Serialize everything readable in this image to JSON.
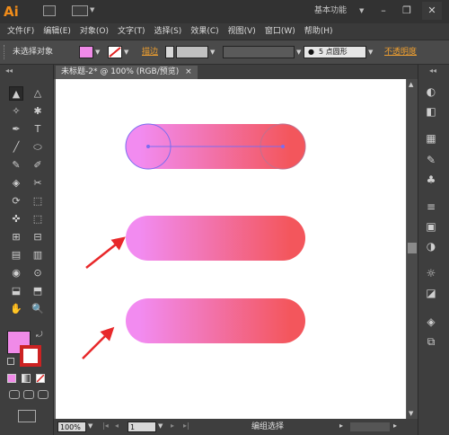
{
  "app": {
    "logo": "Ai",
    "workspace": "基本功能"
  },
  "window_buttons": {
    "minimize": "–",
    "restore": "❐",
    "close": "✕"
  },
  "menu": [
    "文件(F)",
    "编辑(E)",
    "对象(O)",
    "文字(T)",
    "选择(S)",
    "效果(C)",
    "视图(V)",
    "窗口(W)",
    "帮助(H)"
  ],
  "control": {
    "selection_label": "未选择对象",
    "fill_color": "#f08ae8",
    "stroke_label": "描边",
    "brush_label": "5 点圆形",
    "opacity_label": "不透明度"
  },
  "document_tab": {
    "title": "未标题-2* @ 100% (RGB/预览)",
    "close": "×"
  },
  "toolbar": {
    "fill_color": "#f08ae8",
    "tools": [
      "▲",
      "△",
      "✧",
      "✱",
      "✒",
      "T",
      "╱",
      "⬭",
      "✎",
      "✐",
      "◈",
      "✂",
      "⟳",
      "⬚",
      "✜",
      "⬚",
      "⊞",
      "⊟",
      "▤",
      "▥",
      "◉",
      "⊙",
      "⬓",
      "⬒",
      "✋",
      "🔍"
    ]
  },
  "artwork": {
    "gradient_start": "#f28bf0",
    "gradient_end": "#f3565c",
    "arrow_color": "#e8282a",
    "selection_color": "#7b6cf0"
  },
  "status": {
    "zoom": "100%",
    "page": "1",
    "tool_status": "编组选择"
  }
}
